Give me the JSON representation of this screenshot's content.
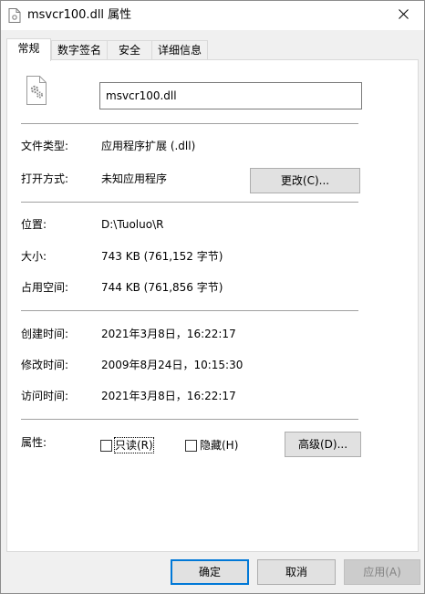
{
  "window": {
    "title": "msvcr100.dll 属性",
    "close_glyph": "✕"
  },
  "tabs": [
    {
      "label": "常规",
      "active": true
    },
    {
      "label": "数字签名",
      "active": false
    },
    {
      "label": "安全",
      "active": false
    },
    {
      "label": "详细信息",
      "active": false
    }
  ],
  "general": {
    "file_name": "msvcr100.dll",
    "file_type_label": "文件类型:",
    "file_type_value": "应用程序扩展 (.dll)",
    "open_with_label": "打开方式:",
    "open_with_value": "未知应用程序",
    "change_button": "更改(C)...",
    "location_label": "位置:",
    "location_value": "D:\\Tuoluo\\R",
    "size_label": "大小:",
    "size_value": "743 KB (761,152 字节)",
    "size_on_disk_label": "占用空间:",
    "size_on_disk_value": "744 KB (761,856 字节)",
    "created_label": "创建时间:",
    "created_value": "2021年3月8日，16:22:17",
    "modified_label": "修改时间:",
    "modified_value": "2009年8月24日，10:15:30",
    "accessed_label": "访问时间:",
    "accessed_value": "2021年3月8日，16:22:17",
    "attributes_label": "属性:",
    "readonly_label": "只读(R)",
    "readonly_checked": false,
    "hidden_label": "隐藏(H)",
    "hidden_checked": false,
    "advanced_button": "高级(D)..."
  },
  "footer": {
    "ok": "确定",
    "cancel": "取消",
    "apply": "应用(A)"
  },
  "colors": {
    "focus_border": "#0078d7",
    "dialog_bg": "#f0f0f0",
    "panel_bg": "#ffffff"
  }
}
